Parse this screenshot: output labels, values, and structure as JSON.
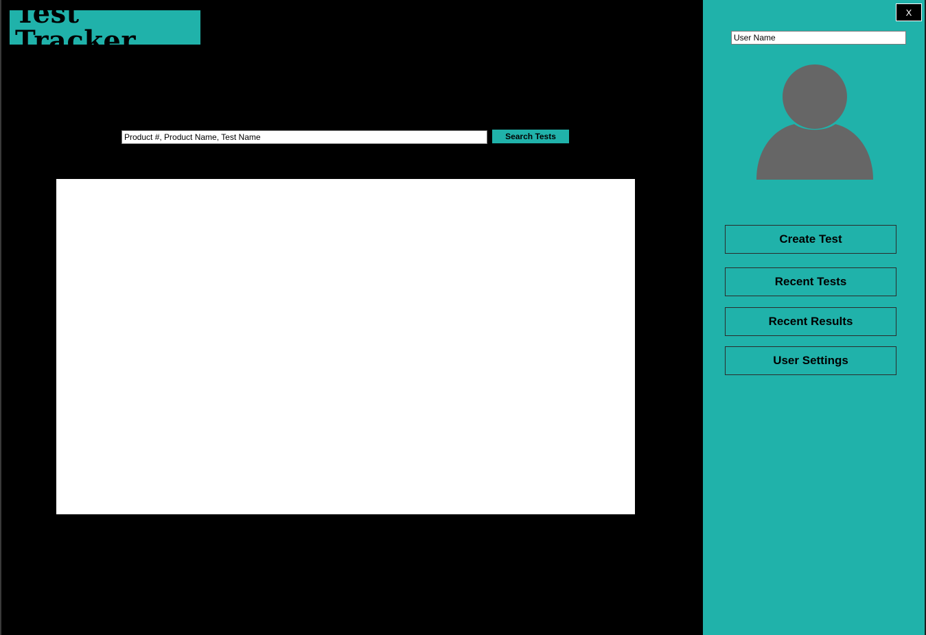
{
  "app": {
    "title": "Test Tracker"
  },
  "search": {
    "value": "Product #, Product Name, Test Name",
    "button_label": "Search Tests"
  },
  "results": {
    "items": []
  },
  "sidebar": {
    "close_label": "X",
    "username": {
      "value": "User Name"
    },
    "avatar_icon": "user-silhouette-icon",
    "nav": [
      {
        "label": "Create Test"
      },
      {
        "label": "Recent Tests"
      },
      {
        "label": "Recent Results"
      },
      {
        "label": "User Settings"
      }
    ]
  },
  "colors": {
    "accent": "#20b2aa",
    "background": "#000000",
    "panel": "#ffffff",
    "avatar": "#666666"
  }
}
